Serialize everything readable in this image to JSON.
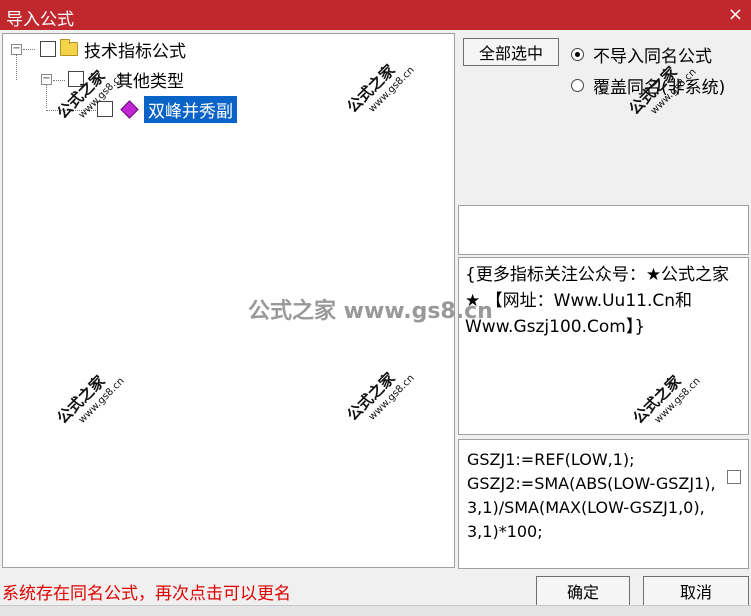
{
  "window": {
    "title": "导入公式",
    "close_glyph": "×"
  },
  "tree": {
    "root": {
      "label": "技术指标公式"
    },
    "group": {
      "label": "其他类型"
    },
    "item": {
      "label": "双峰并秀副",
      "selected": true
    }
  },
  "buttons": {
    "select_all": "全部选中",
    "ok": "确定",
    "cancel": "取消"
  },
  "radios": [
    {
      "label": "不导入同名公式",
      "checked": true
    },
    {
      "label": "覆盖同名(非系统)",
      "checked": false
    }
  ],
  "description": "{更多指标关注公众号：★公式之家★ 【网址：Www.Uu11.Cn和Www.Gszj100.Com】}",
  "code": "GSZJ1:=REF(LOW,1);\nGSZJ2:=SMA(ABS(LOW-GSZJ1),3,1)/SMA(MAX(LOW-GSZJ1,0),3,1)*100;",
  "status": "系统存在同名公式，再次点击可以更名",
  "watermark": {
    "main": "公式之家",
    "sub": "www.gs8.cn",
    "center": "公式之家 www.gs8.cn"
  }
}
